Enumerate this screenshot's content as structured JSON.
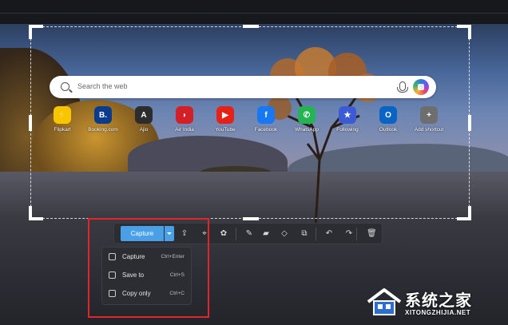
{
  "search": {
    "placeholder": "Search the web"
  },
  "tiles": [
    {
      "label": "Flipkart",
      "glyph": "⚡",
      "color": "#f7c600",
      "icon": "flipkart-icon"
    },
    {
      "label": "Booking.com",
      "glyph": "B.",
      "color": "#0b3b8c",
      "icon": "booking-icon"
    },
    {
      "label": "Ajio",
      "glyph": "A",
      "color": "#2c2c2c",
      "icon": "ajio-icon"
    },
    {
      "label": "Air India",
      "glyph": "◗",
      "color": "#d31f26",
      "icon": "air-india-icon"
    },
    {
      "label": "YouTube",
      "glyph": "▶",
      "color": "#e62117",
      "icon": "youtube-icon"
    },
    {
      "label": "Facebook",
      "glyph": "f",
      "color": "#1877f2",
      "icon": "facebook-icon"
    },
    {
      "label": "WhatsApp",
      "glyph": "✆",
      "color": "#25b454",
      "icon": "whatsapp-icon"
    },
    {
      "label": "Following",
      "glyph": "★",
      "color": "#3c5ad6",
      "icon": "following-icon"
    },
    {
      "label": "Outlook",
      "glyph": "O",
      "color": "#0a64c4",
      "icon": "outlook-icon"
    },
    {
      "label": "Add shortcut",
      "glyph": "+",
      "color": "#6e6e6e",
      "icon": "add-icon"
    }
  ],
  "toolbar": {
    "capture_label": "Capture",
    "icons": [
      {
        "name": "share-icon",
        "glyph": "⇪"
      },
      {
        "name": "visual-search-icon",
        "glyph": "⌖"
      },
      {
        "name": "copilot-icon",
        "glyph": "✿"
      },
      {
        "name": "pen-icon",
        "glyph": "✎"
      },
      {
        "name": "highlighter-icon",
        "glyph": "▰"
      },
      {
        "name": "eraser-icon",
        "glyph": "◇"
      },
      {
        "name": "shapes-icon",
        "glyph": "⧉"
      },
      {
        "name": "undo-icon",
        "glyph": "↶"
      },
      {
        "name": "redo-icon",
        "glyph": "↷"
      },
      {
        "name": "delete-icon",
        "glyph": "🗑"
      }
    ]
  },
  "capture_menu": {
    "items": [
      {
        "label": "Capture",
        "shortcut": "Ctrl+Enter",
        "icon": "camera-icon"
      },
      {
        "label": "Save to",
        "shortcut": "Ctrl+S",
        "icon": "save-icon"
      },
      {
        "label": "Copy only",
        "shortcut": "Ctrl+C",
        "icon": "copy-icon"
      }
    ]
  },
  "watermark": {
    "chinese": "系统之家",
    "latin": "XITONGZHIJIA.NET"
  },
  "colors": {
    "accent": "#4aa0e6",
    "highlight_box": "#e0262b"
  }
}
